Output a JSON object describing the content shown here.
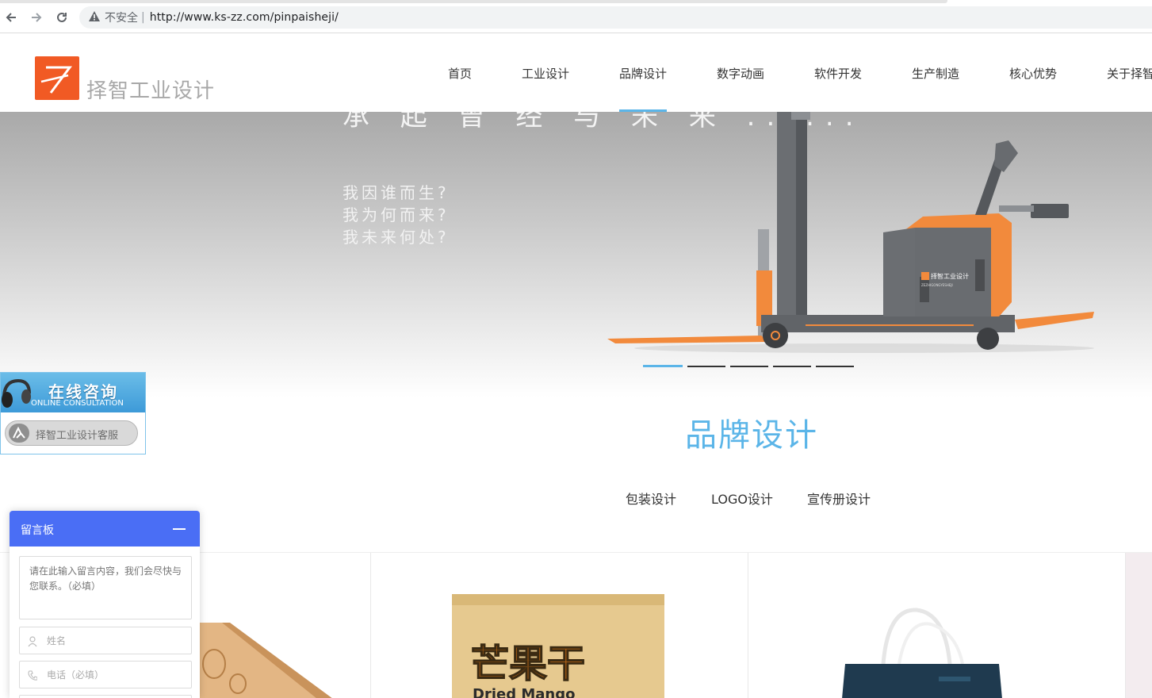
{
  "browser": {
    "insecure_label": "不安全",
    "separator": "|",
    "url": "http://www.ks-zz.com/pinpaisheji/",
    "icons": [
      "back-arrow-icon",
      "forward-arrow-icon",
      "reload-icon",
      "warning-icon"
    ]
  },
  "header": {
    "logo_text": "择智工业设计",
    "nav": [
      {
        "label": "首页",
        "active": false
      },
      {
        "label": "工业设计",
        "active": false
      },
      {
        "label": "品牌设计",
        "active": true
      },
      {
        "label": "数字动画",
        "active": false
      },
      {
        "label": "软件开发",
        "active": false
      },
      {
        "label": "生产制造",
        "active": false
      },
      {
        "label": "核心优势",
        "active": false
      },
      {
        "label": "关于择智",
        "active": false
      }
    ]
  },
  "hero": {
    "headline": "承 起 曾 经 与 未 来 ......",
    "lines": [
      "我因谁而生?",
      "我为何而来?",
      "我未来何处?"
    ],
    "product_badge": "择智工业设计",
    "product_badge_sub": "ZEZHIGONGYESHEJI",
    "slides": 5,
    "active_slide": 1
  },
  "section": {
    "title": "品牌设计",
    "tabs": [
      "包装设计",
      "LOGO设计",
      "宣传册设计"
    ]
  },
  "products": {
    "mango_title": "芒果干",
    "mango_subtitle": "Dried Mango"
  },
  "consult": {
    "title": "在线咨询",
    "subtitle": "ONLINE CONSULTATION",
    "button_label": "择智工业设计客服"
  },
  "message_board": {
    "title": "留言板",
    "content_placeholder": "请在此输入留言内容，我们会尽快与您联系。（必填）",
    "name_placeholder": "姓名",
    "phone_placeholder": "电话（必填）"
  },
  "colors": {
    "accent_blue": "#5bb5e8",
    "logo_orange": "#f15a24",
    "board_blue": "#4a6ef5"
  }
}
